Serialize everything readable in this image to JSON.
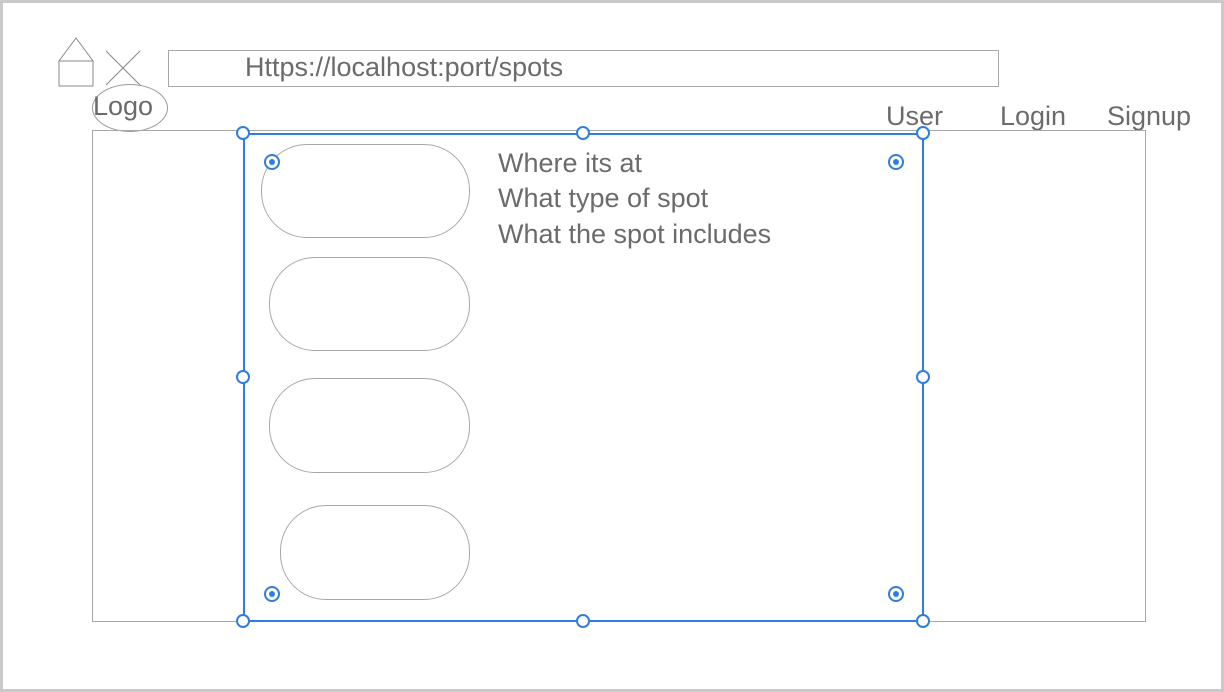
{
  "browser": {
    "url": "Https://localhost:port/spots",
    "icons": [
      "home-icon",
      "close-icon"
    ]
  },
  "header": {
    "logo_label": "Logo",
    "nav": {
      "user": "User",
      "login": "Login",
      "signup": "Signup"
    }
  },
  "main": {
    "cards_count": 4,
    "info_lines": [
      "Where its at",
      "What type of spot",
      "What the spot includes"
    ]
  },
  "colors": {
    "selection": "#2f7de1",
    "wire": "#a8a8a8",
    "text": "#6b6b6b"
  }
}
